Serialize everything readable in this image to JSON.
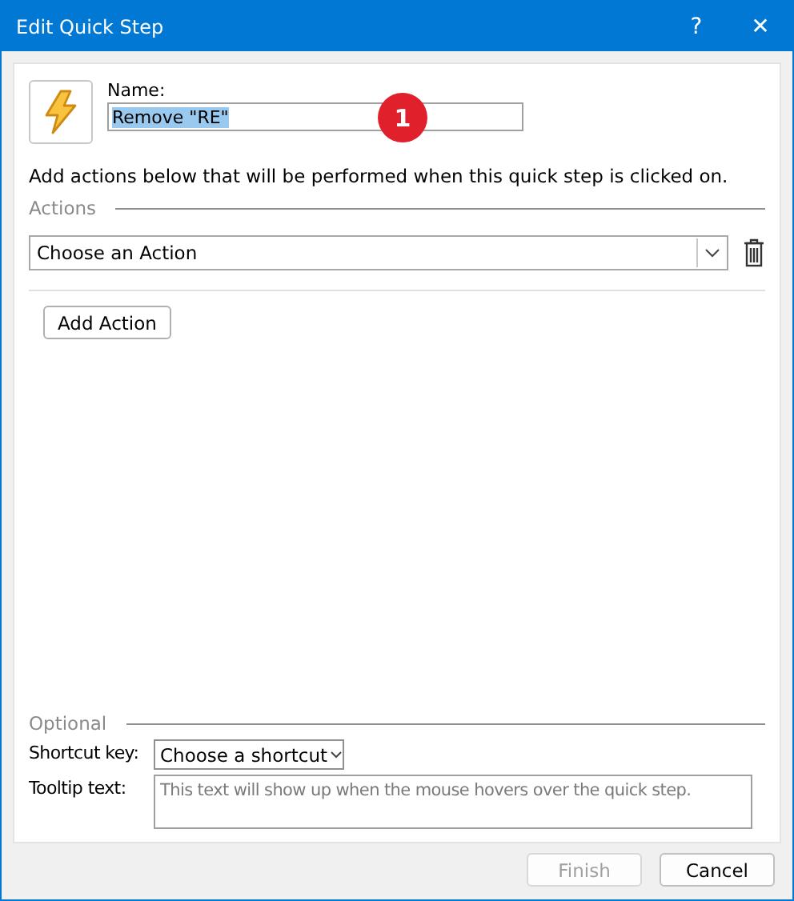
{
  "window": {
    "title": "Edit Quick Step",
    "help": "?",
    "close": "✕"
  },
  "name_field": {
    "label": "Name:",
    "value": "Remove \"RE\"",
    "value_selected": true
  },
  "callout": {
    "label": "1"
  },
  "instructions": "Add actions below that will be performed when this quick step is clicked on.",
  "actions_section": {
    "heading": "Actions",
    "actions": [
      {
        "value": "Choose an Action"
      }
    ],
    "add_button": "Add Action"
  },
  "optional_section": {
    "heading": "Optional",
    "shortcut": {
      "label": "Shortcut key:",
      "value": "Choose a shortcut"
    },
    "tooltip": {
      "label": "Tooltip text:",
      "placeholder": "This text will show up when the mouse hovers over the quick step."
    }
  },
  "buttons": [
    {
      "label": "Finish",
      "disabled": true
    },
    {
      "label": "Cancel",
      "disabled": false
    }
  ]
}
